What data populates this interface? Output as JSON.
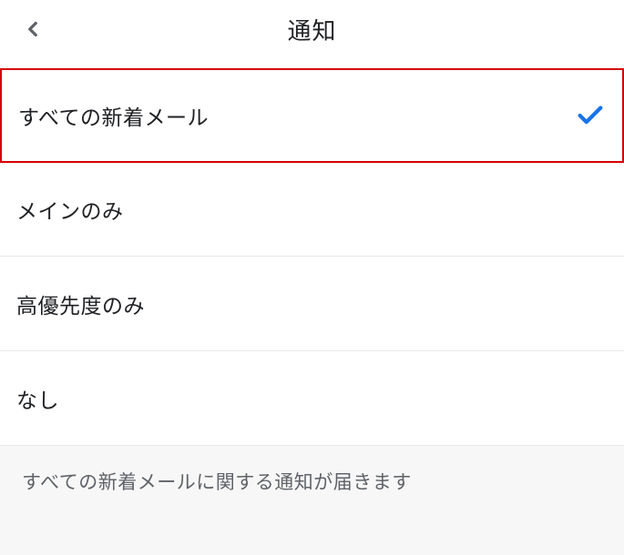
{
  "header": {
    "title": "通知"
  },
  "options": [
    {
      "label": "すべての新着メール",
      "selected": true,
      "highlighted": true
    },
    {
      "label": "メインのみ",
      "selected": false,
      "highlighted": false
    },
    {
      "label": "高優先度のみ",
      "selected": false,
      "highlighted": false
    },
    {
      "label": "なし",
      "selected": false,
      "highlighted": false
    }
  ],
  "description": "すべての新着メールに関する通知が届きます",
  "colors": {
    "accent": "#1a73e8",
    "highlight_border": "#d50000"
  }
}
